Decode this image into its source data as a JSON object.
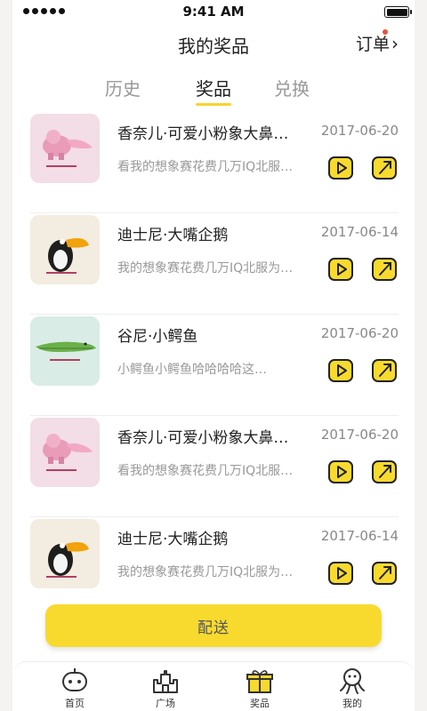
{
  "status_bar": {
    "time": "9:41 AM"
  },
  "header": {
    "title": "我的奖品",
    "order_label": "订单"
  },
  "tabs": [
    {
      "label": "历史",
      "active": false
    },
    {
      "label": "奖品",
      "active": true
    },
    {
      "label": "兑换",
      "active": false
    }
  ],
  "items": [
    {
      "title": "香奈儿·可爱小粉象大鼻…",
      "date": "2017-06-20",
      "desc": "看我的想象赛花费几万IQ北服…",
      "thumb": "pink-elephant"
    },
    {
      "title": "迪士尼·大嘴企鹅",
      "date": "2017-06-14",
      "desc": "我的想象赛花费几万IQ北服为…",
      "thumb": "toucan"
    },
    {
      "title": "谷尼·小鳄鱼",
      "date": "2017-06-20",
      "desc": "小鳄鱼小鳄鱼哈哈哈哈这…",
      "thumb": "crocodile"
    },
    {
      "title": "香奈儿·可爱小粉象大鼻…",
      "date": "2017-06-20",
      "desc": "看我的想象赛花费几万IQ北服…",
      "thumb": "pink-elephant"
    },
    {
      "title": "迪士尼·大嘴企鹅",
      "date": "2017-06-14",
      "desc": "我的想象赛花费几万IQ北服为…",
      "thumb": "toucan"
    }
  ],
  "deliver_button": "配送",
  "tabbar": [
    {
      "label": "首页",
      "icon": "robot-face-icon"
    },
    {
      "label": "广场",
      "icon": "castle-icon"
    },
    {
      "label": "奖品",
      "icon": "gift-box-icon",
      "active": true
    },
    {
      "label": "我的",
      "icon": "octopus-icon"
    }
  ],
  "colors": {
    "accent": "#f8da2f",
    "dot": "#e8513b"
  }
}
